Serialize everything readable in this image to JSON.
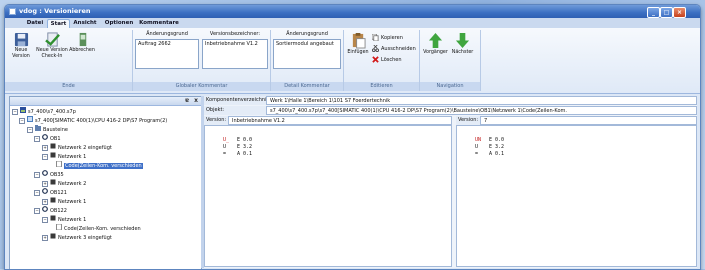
{
  "window": {
    "title": "vdog : Versionieren"
  },
  "tabs": [
    "Datei",
    "Start",
    "Ansicht",
    "Optionen",
    "Kommentare"
  ],
  "active_tab": "Start",
  "ribbon": {
    "ende": {
      "label": "Ende",
      "buttons": [
        "Neue Version",
        "Neue Version Check-In",
        "Abbrechen"
      ]
    },
    "globaler": {
      "label": "Globaler Kommentar",
      "fields": [
        {
          "label": "Änderungsgrund",
          "value": "Auftrag 2662"
        },
        {
          "label": "Versionsbezeichner:",
          "value": "Inbetriebnahme V1.2"
        }
      ]
    },
    "detail": {
      "label": "Detail Kommentar",
      "field": {
        "label": "Änderungsgrund",
        "value": "Sortiermodul angebaut"
      }
    },
    "editieren": {
      "label": "Editieren",
      "paste": "Einfügen",
      "copy": "Kopieren",
      "cut": "Ausschneiden",
      "delete": "Löschen"
    },
    "navigation": {
      "label": "Navigation",
      "prev": "Vorgänger",
      "next": "Nächster"
    }
  },
  "tree_header": {
    "pin": "ɐ",
    "close": "x"
  },
  "tree": [
    {
      "label": "s7_400\\s7_400.s7p",
      "toggle": "⊟",
      "icon": "project"
    },
    {
      "label": "s7_400[SIMATIC 400(1)\\CPU 416-2 DP\\S7 Program(2)",
      "toggle": "⊟",
      "icon": "program"
    },
    {
      "label": "Bausteine",
      "toggle": "⊟",
      "icon": "folder"
    },
    {
      "label": "OB1",
      "toggle": "⊟",
      "icon": "block"
    },
    {
      "label": "Netzwerk 2 eingefügt",
      "toggle": "⊞",
      "icon": "network"
    },
    {
      "label": "Netzwerk 1",
      "toggle": "⊟",
      "icon": "network"
    },
    {
      "label": "Code(Zeilen-Kom. verschieden",
      "toggle": "",
      "icon": "code"
    },
    {
      "label": "OB35",
      "toggle": "⊟",
      "icon": "block"
    },
    {
      "label": "Netzwerk 2",
      "toggle": "⊞",
      "icon": "network"
    },
    {
      "label": "OB121",
      "toggle": "⊟",
      "icon": "block"
    },
    {
      "label": "Netzwerk 1",
      "toggle": "⊞",
      "icon": "network"
    },
    {
      "label": "OB122",
      "toggle": "⊟",
      "icon": "block"
    },
    {
      "label": "Netzwerk 1",
      "toggle": "⊟",
      "icon": "network"
    },
    {
      "label": "Code(Zeilen-Kom. verschieden",
      "toggle": "",
      "icon": "code"
    },
    {
      "label": "Netzwerk 3 eingefügt",
      "toggle": "⊞",
      "icon": "network"
    }
  ],
  "props": {
    "komponenten_label": "Komponentenverzeichnis:",
    "komponenten_value": "Werk 1\\Halle 1\\Bereich 1\\101 S7 Foerdertechnik",
    "objekt_label": "Objekt:",
    "objekt_value": "s7_400\\s7_400.s7p\\s7_400[SIMATIC 400(1)\\CPU 416-2 DP\\S7 Program(2)\\Bausteine\\OB1\\Netzwerk 1\\Code(Zeilen-Kom."
  },
  "left_panel": {
    "label": "Version:",
    "value": "Inbetriebnahme V1.2",
    "code": [
      {
        "op": "U_",
        "operand": "E 0.0",
        "changed": true
      },
      {
        "op": "U",
        "operand": "E 3.2",
        "changed": false
      },
      {
        "op": "=",
        "operand": "A 0.1",
        "changed": false
      }
    ]
  },
  "right_panel": {
    "label": "Version:",
    "value": "7",
    "code": [
      {
        "op": "UN",
        "operand": "E 0.0",
        "changed": true
      },
      {
        "op": "U",
        "operand": "E 3.2",
        "changed": false
      },
      {
        "op": "=",
        "operand": "A 0.1",
        "changed": false
      }
    ]
  }
}
